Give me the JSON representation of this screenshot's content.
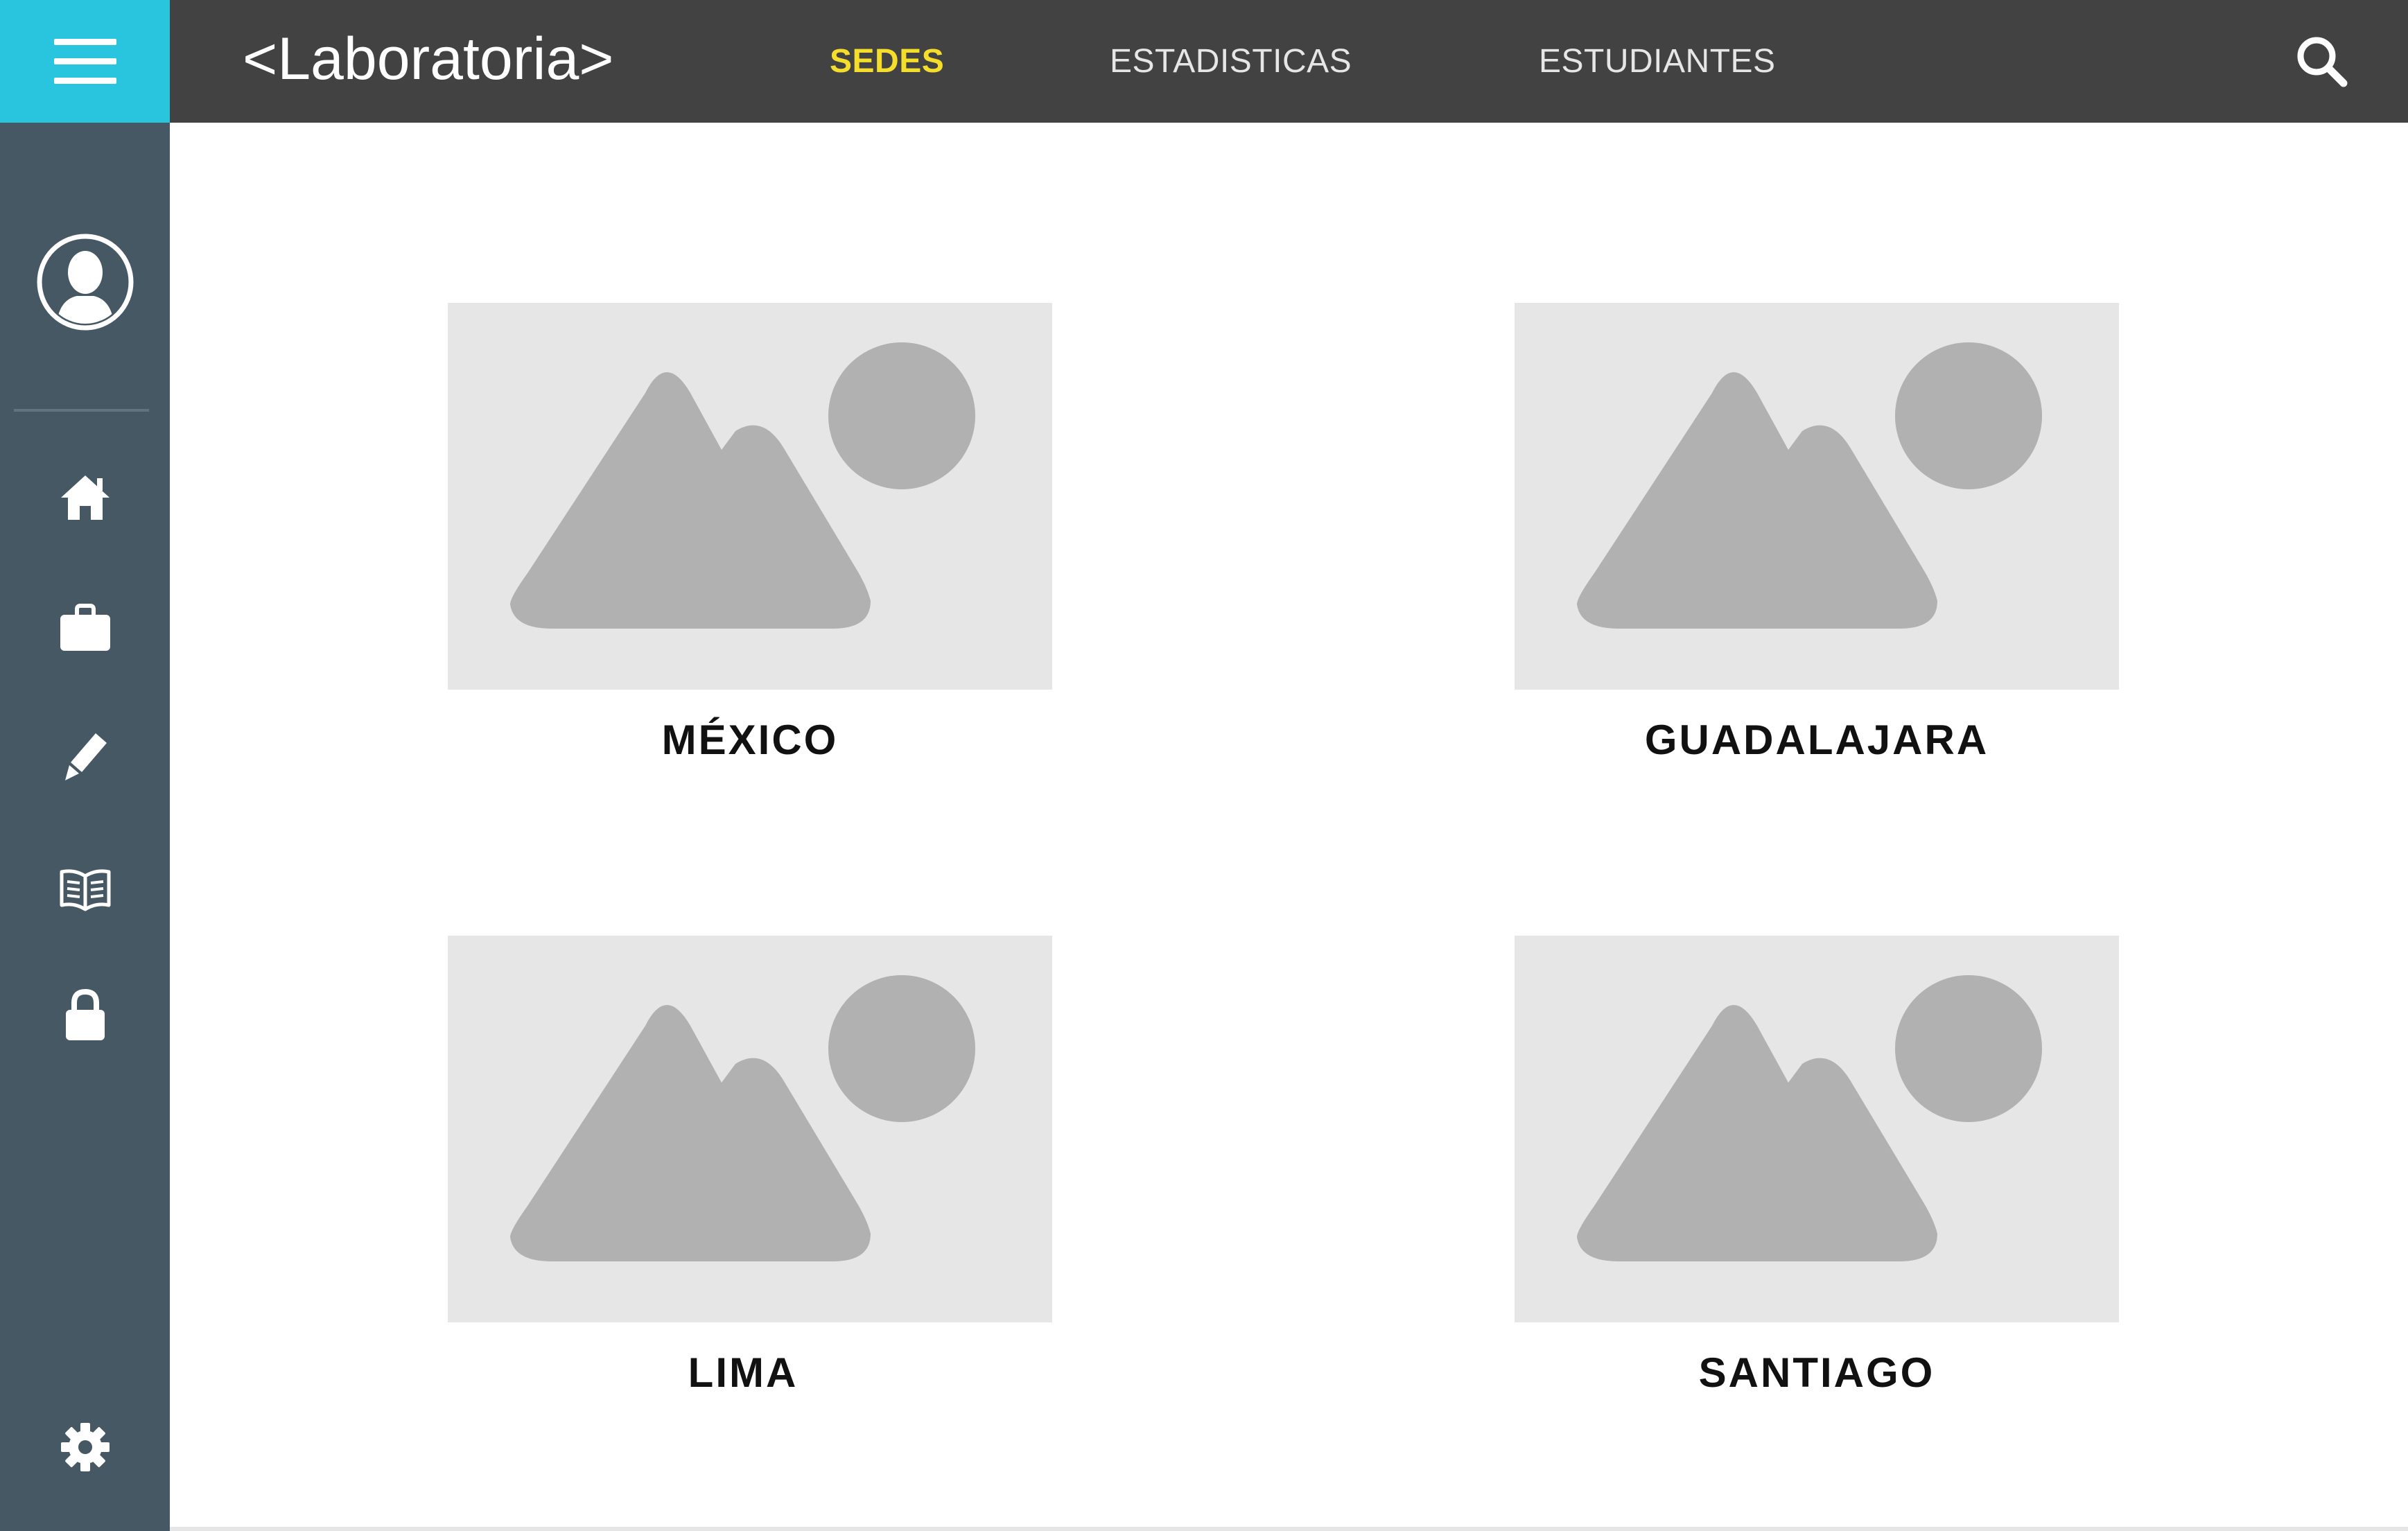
{
  "header": {
    "logo": "<Laboratoria>",
    "nav": [
      {
        "label": "SEDES",
        "active": true
      },
      {
        "label": "ESTADISTICAS",
        "active": false
      },
      {
        "label": "ESTUDIANTES",
        "active": false
      }
    ]
  },
  "icons": {
    "menu": "hamburger-menu-icon",
    "search": "search-icon",
    "profile": "user-avatar-icon",
    "sidebar": [
      "home-icon",
      "briefcase-icon",
      "pencil-icon",
      "book-icon",
      "lock-icon"
    ],
    "settings": "gear-icon"
  },
  "sedes": [
    {
      "name": "MÉXICO"
    },
    {
      "name": "GUADALAJARA"
    },
    {
      "name": "LIMA"
    },
    {
      "name": "SANTIAGO"
    }
  ],
  "colors": {
    "accent": "#29c5de",
    "topbar": "#424242",
    "sidebar": "#455863",
    "active_nav": "#f5dd2c",
    "placeholder_bg": "#e6e6e6",
    "placeholder_fg": "#b1b1b1"
  }
}
